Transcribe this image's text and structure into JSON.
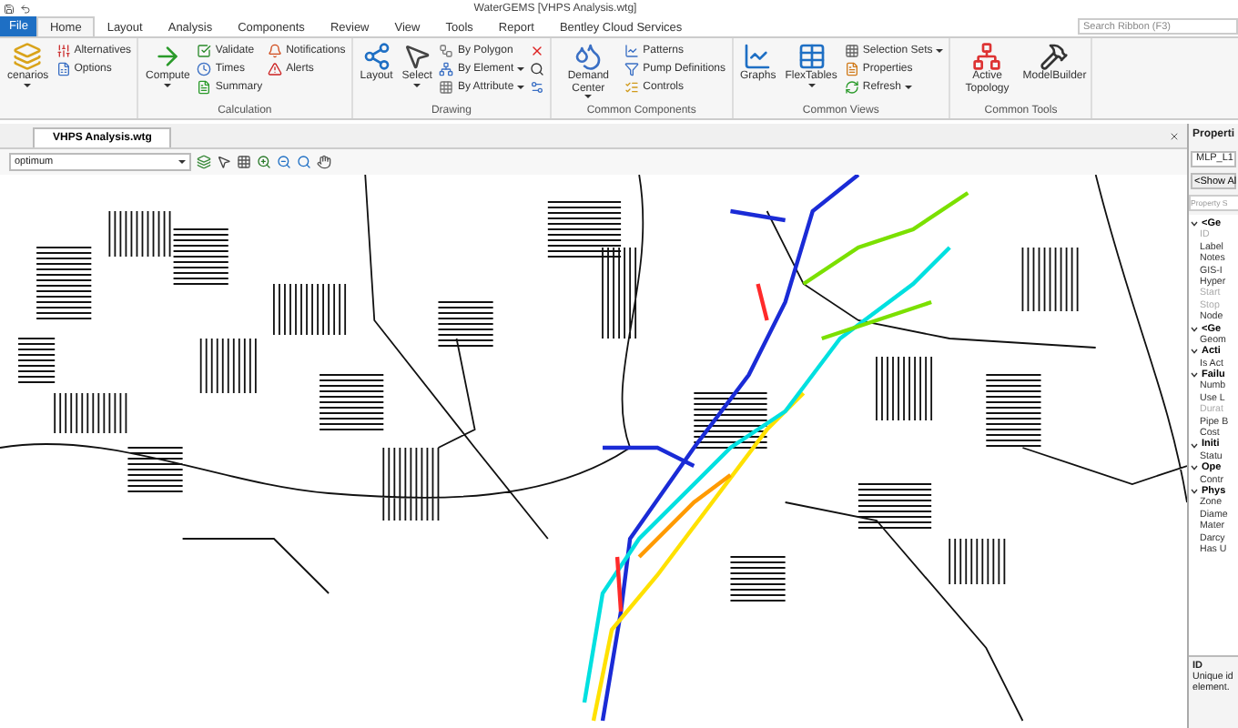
{
  "window": {
    "title": "WaterGEMS [VHPS Analysis.wtg]"
  },
  "ribbon": {
    "file_button": "File",
    "tabs": [
      {
        "label": "Home",
        "selected": true
      },
      {
        "label": "Layout",
        "selected": false
      },
      {
        "label": "Analysis",
        "selected": false
      },
      {
        "label": "Components",
        "selected": false
      },
      {
        "label": "Review",
        "selected": false
      },
      {
        "label": "View",
        "selected": false
      },
      {
        "label": "Tools",
        "selected": false
      },
      {
        "label": "Report",
        "selected": false
      },
      {
        "label": "Bentley Cloud Services",
        "selected": false
      }
    ],
    "search": {
      "placeholder": "Search Ribbon (F3)"
    },
    "groups": [
      {
        "columns": [
          {
            "kind": "large",
            "label": "cenarios",
            "has_menu": true
          },
          {
            "kind": "stack",
            "items": [
              {
                "label": "Alternatives",
                "has_menu": false
              },
              {
                "label": "Options",
                "has_menu": false
              }
            ]
          }
        ]
      },
      {
        "label": "Calculation",
        "columns": [
          {
            "kind": "large",
            "label": "Compute",
            "has_menu": true
          },
          {
            "kind": "stack",
            "items": [
              {
                "label": "Validate",
                "has_menu": false
              },
              {
                "label": "Times",
                "has_menu": false
              },
              {
                "label": "Summary",
                "has_menu": false
              }
            ]
          },
          {
            "kind": "stack",
            "items": [
              {
                "label": "Notifications",
                "has_menu": false
              },
              {
                "label": "Alerts",
                "has_menu": false
              }
            ]
          }
        ]
      },
      {
        "label": "Drawing",
        "columns": [
          {
            "kind": "large",
            "label": "Layout",
            "has_menu": false
          },
          {
            "kind": "large",
            "label": "Select",
            "has_menu": true
          },
          {
            "kind": "stack",
            "items": [
              {
                "label": "By Polygon",
                "has_menu": false
              },
              {
                "label": "By Element",
                "has_menu": true
              },
              {
                "label": "By Attribute",
                "has_menu": true
              }
            ]
          },
          {
            "kind": "tools"
          }
        ]
      },
      {
        "label": "Common Components",
        "columns": [
          {
            "kind": "large",
            "label": "Demand Center",
            "has_menu": true
          },
          {
            "kind": "stack",
            "items": [
              {
                "label": "Patterns",
                "has_menu": false
              },
              {
                "label": "Pump Definitions",
                "has_menu": false
              },
              {
                "label": "Controls",
                "has_menu": false
              }
            ]
          }
        ]
      },
      {
        "label": "Common Views",
        "columns": [
          {
            "kind": "large",
            "label": "Graphs",
            "has_menu": false
          },
          {
            "kind": "large",
            "label": "FlexTables",
            "has_menu": true
          },
          {
            "kind": "stack",
            "items": [
              {
                "label": "Selection Sets",
                "has_menu": true
              },
              {
                "label": "Properties",
                "has_menu": false
              },
              {
                "label": "Refresh",
                "has_menu": true
              }
            ]
          }
        ]
      },
      {
        "label": "Common Tools",
        "columns": [
          {
            "kind": "large",
            "label": "Active Topology",
            "has_menu": false
          },
          {
            "kind": "large",
            "label": "ModelBuilder",
            "has_menu": false
          }
        ]
      }
    ]
  },
  "document": {
    "tab": "VHPS Analysis.wtg",
    "scenario": "optimum"
  },
  "properties": {
    "title": "Properti",
    "element": "MLP_L1",
    "show_all": "<Show Al",
    "search": {
      "placeholder": "Property S"
    },
    "categories": [
      {
        "label": "<Ge",
        "expanded": true,
        "children": [
          {
            "label": "ID",
            "disabled": true
          },
          {
            "label": "Label",
            "disabled": false
          },
          {
            "label": "Notes",
            "disabled": false
          },
          {
            "label": "GIS-I",
            "disabled": false
          },
          {
            "label": "Hyper",
            "disabled": false
          },
          {
            "label": "Start",
            "disabled": true
          },
          {
            "label": "Stop",
            "disabled": true
          },
          {
            "label": "Node",
            "disabled": false
          }
        ]
      },
      {
        "label": "<Ge",
        "expanded": true,
        "children": [
          {
            "label": "Geom",
            "disabled": false
          }
        ]
      },
      {
        "label": "Acti",
        "expanded": true,
        "children": [
          {
            "label": "Is Act",
            "disabled": false
          }
        ]
      },
      {
        "label": "Failu",
        "expanded": true,
        "children": [
          {
            "label": "Numb",
            "disabled": false
          },
          {
            "label": "Use L",
            "disabled": false
          },
          {
            "label": "Durat",
            "disabled": true
          },
          {
            "label": "Pipe B",
            "disabled": false
          },
          {
            "label": "Cost",
            "disabled": false
          }
        ]
      },
      {
        "label": "Initi",
        "expanded": true,
        "children": [
          {
            "label": "Statu",
            "disabled": false
          }
        ]
      },
      {
        "label": "Ope",
        "expanded": true,
        "children": [
          {
            "label": "Contr",
            "disabled": false
          }
        ]
      },
      {
        "label": "Phys",
        "expanded": true,
        "children": [
          {
            "label": "Zone",
            "disabled": false
          },
          {
            "label": "Diame",
            "disabled": false
          },
          {
            "label": "Mater",
            "disabled": false
          },
          {
            "label": "Darcy",
            "disabled": false
          },
          {
            "label": "Has U",
            "disabled": false
          }
        ]
      }
    ],
    "help": {
      "title": "ID",
      "text": "Unique id element."
    }
  }
}
